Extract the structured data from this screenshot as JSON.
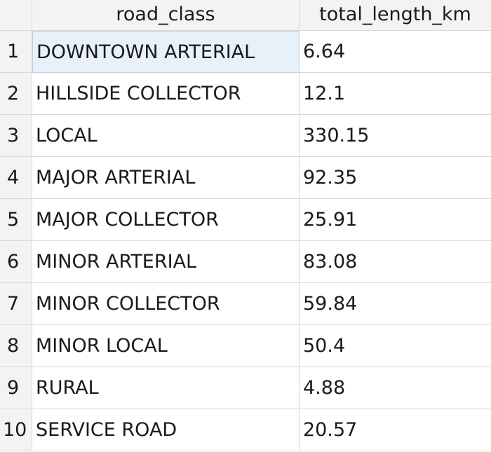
{
  "table": {
    "columns": [
      "road_class",
      "total_length_km"
    ],
    "rows": [
      {
        "index": "1",
        "road_class": "DOWNTOWN ARTERIAL",
        "total_length_km": "6.64"
      },
      {
        "index": "2",
        "road_class": "HILLSIDE COLLECTOR",
        "total_length_km": "12.1"
      },
      {
        "index": "3",
        "road_class": "LOCAL",
        "total_length_km": "330.15"
      },
      {
        "index": "4",
        "road_class": "MAJOR ARTERIAL",
        "total_length_km": "92.35"
      },
      {
        "index": "5",
        "road_class": "MAJOR COLLECTOR",
        "total_length_km": "25.91"
      },
      {
        "index": "6",
        "road_class": "MINOR ARTERIAL",
        "total_length_km": "83.08"
      },
      {
        "index": "7",
        "road_class": "MINOR COLLECTOR",
        "total_length_km": "59.84"
      },
      {
        "index": "8",
        "road_class": "MINOR LOCAL",
        "total_length_km": "50.4"
      },
      {
        "index": "9",
        "road_class": "RURAL",
        "total_length_km": "4.88"
      },
      {
        "index": "10",
        "road_class": "SERVICE ROAD",
        "total_length_km": "20.57"
      }
    ],
    "selected_cell": {
      "row": 0,
      "column": "road_class"
    },
    "colors": {
      "header_bg": "#f3f3f3",
      "grid_line": "#d8d8d8",
      "selection_bg": "#e8f0f8",
      "selection_border": "#b9d1ea"
    }
  }
}
